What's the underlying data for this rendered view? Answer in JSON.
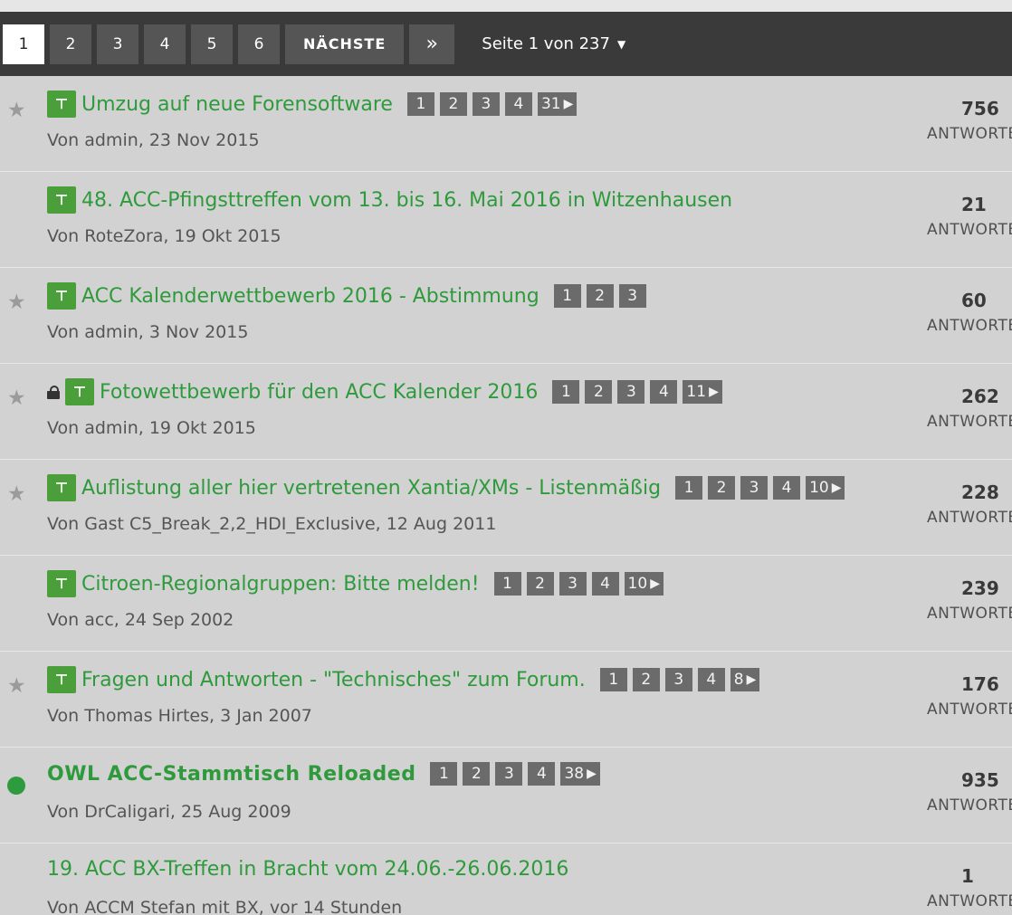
{
  "pagination": {
    "pages": [
      "1",
      "2",
      "3",
      "4",
      "5",
      "6"
    ],
    "active_index": 0,
    "next_label": "NÄCHSTE",
    "last_label": "»",
    "page_info": "Seite 1 von 237"
  },
  "reply_label": "ANTWORTEN",
  "topics": [
    {
      "starred": true,
      "locked": false,
      "pinned": true,
      "unread": false,
      "title": "Umzug auf neue Forensoftware",
      "pages": [
        "1",
        "2",
        "3",
        "4",
        "31"
      ],
      "meta": "Von admin, 23 Nov 2015",
      "replies": "756"
    },
    {
      "starred": false,
      "locked": false,
      "pinned": true,
      "unread": false,
      "title": "48. ACC-Pfingsttreffen vom 13. bis 16. Mai 2016 in Witzenhausen",
      "pages": [],
      "meta": "Von RoteZora, 19 Okt 2015",
      "replies": "21"
    },
    {
      "starred": true,
      "locked": false,
      "pinned": true,
      "unread": false,
      "title": "ACC Kalenderwettbewerb 2016 - Abstimmung",
      "pages": [
        "1",
        "2",
        "3"
      ],
      "meta": "Von admin, 3 Nov 2015",
      "replies": "60"
    },
    {
      "starred": true,
      "locked": true,
      "pinned": true,
      "unread": false,
      "title": "Fotowettbewerb für den ACC Kalender 2016",
      "pages": [
        "1",
        "2",
        "3",
        "4",
        "11"
      ],
      "meta": "Von admin, 19 Okt 2015",
      "replies": "262"
    },
    {
      "starred": true,
      "locked": false,
      "pinned": true,
      "unread": false,
      "title": "Auflistung aller hier vertretenen Xantia/XMs - Listenmäßig",
      "pages": [
        "1",
        "2",
        "3",
        "4",
        "10"
      ],
      "meta": "Von Gast C5_Break_2,2_HDI_Exclusive, 12 Aug 2011",
      "replies": "228"
    },
    {
      "starred": false,
      "locked": false,
      "pinned": true,
      "unread": false,
      "title": "Citroen-Regionalgruppen: Bitte melden!",
      "pages": [
        "1",
        "2",
        "3",
        "4",
        "10"
      ],
      "meta": "Von acc, 24 Sep 2002",
      "replies": "239"
    },
    {
      "starred": true,
      "locked": false,
      "pinned": true,
      "unread": false,
      "title": "Fragen und Antworten - \"Technisches\" zum Forum.",
      "pages": [
        "1",
        "2",
        "3",
        "4",
        "8"
      ],
      "meta": "Von Thomas Hirtes, 3 Jan 2007",
      "replies": "176"
    },
    {
      "starred": false,
      "locked": false,
      "pinned": false,
      "unread": true,
      "title": "OWL ACC-Stammtisch Reloaded",
      "pages": [
        "1",
        "2",
        "3",
        "4",
        "38"
      ],
      "meta": "Von DrCaligari, 25 Aug 2009",
      "replies": "935"
    },
    {
      "starred": false,
      "locked": false,
      "pinned": false,
      "unread": false,
      "title": "19. ACC BX-Treffen in Bracht vom 24.06.-26.06.2016",
      "pages": [],
      "meta": "Von ACCM Stefan mit BX, vor 14 Stunden",
      "replies": "1"
    }
  ]
}
